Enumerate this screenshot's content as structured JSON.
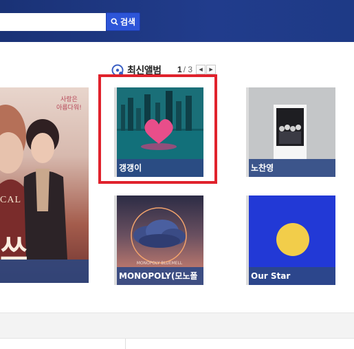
{
  "search": {
    "value": "",
    "placeholder": "",
    "button_label": "검색"
  },
  "section": {
    "title": "최신앨범",
    "page_current": "1",
    "page_total": "/ 3"
  },
  "poster": {
    "tagline_1": "사랑은",
    "tagline_2": "아름다워!",
    "word": "CAL",
    "big": "쓰"
  },
  "albums": [
    {
      "title": "갱갱이"
    },
    {
      "title": "노찬영"
    },
    {
      "title": "MONOPOLY(모노폴"
    },
    {
      "title": "Our Star"
    }
  ],
  "card3_art_text": "MONOPOLY BLUEMELL",
  "colors": {
    "topbar": "#1e3a86",
    "search_button": "#2d55d8",
    "highlight": "#e0222c",
    "caption_bar": "#2e4884"
  }
}
